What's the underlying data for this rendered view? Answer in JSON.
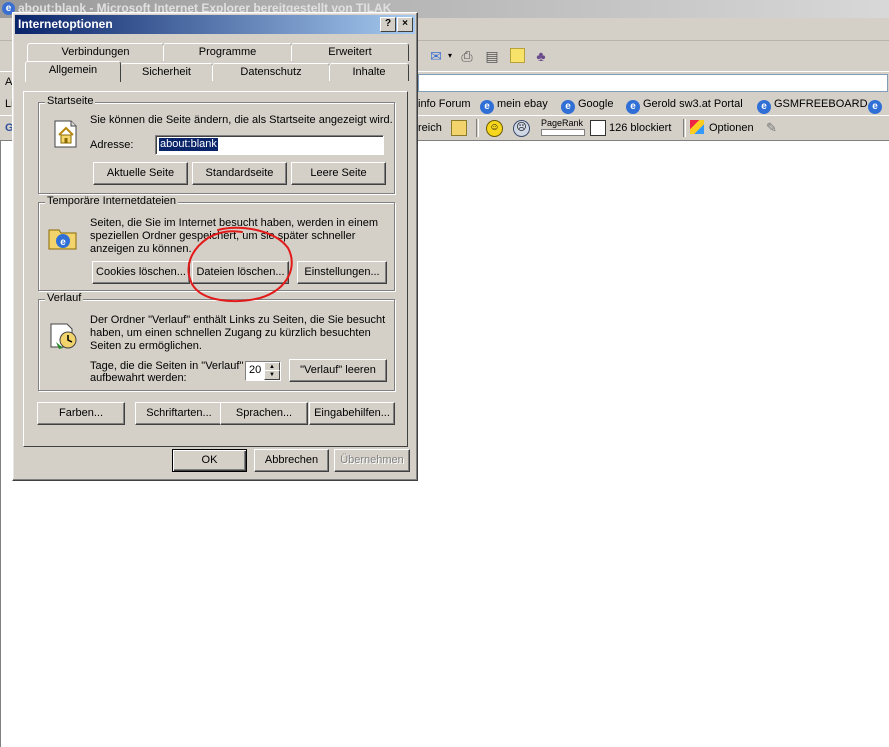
{
  "browser": {
    "title": "about:blank - Microsoft Internet Explorer bereitgestellt von TILAK",
    "address_prefix": "A",
    "links_prefix": "Li",
    "links": [
      "info Forum",
      "mein ebay",
      "Google",
      "Gerold sw3.at  Portal",
      "GSMFREEBOARD"
    ],
    "google_toolbar": {
      "search_fragment": "reich",
      "pagerank_label": "PageRank",
      "blocked_label": "126 blockiert",
      "options_label": "Optionen"
    }
  },
  "dialog": {
    "title": "Internetoptionen",
    "help_btn": "?",
    "close_btn": "×",
    "tabs_row1": [
      "Verbindungen",
      "Programme",
      "Erweitert"
    ],
    "tabs_row2": [
      "Allgemein",
      "Sicherheit",
      "Datenschutz",
      "Inhalte"
    ],
    "active_tab": "Allgemein",
    "startseite": {
      "label": "Startseite",
      "desc": "Sie können die Seite ändern, die als Startseite angezeigt wird.",
      "address_label": "Adresse:",
      "address_value": "about:blank",
      "btn_current": "Aktuelle Seite",
      "btn_default": "Standardseite",
      "btn_blank": "Leere Seite"
    },
    "temp": {
      "label": "Temporäre Internetdateien",
      "desc_line1": "Seiten, die Sie im Internet besucht haben, werden in einem",
      "desc_line2": "speziellen Ordner gespeichert, um sie später schneller",
      "desc_line3": "anzeigen zu können.",
      "btn_cookies": "Cookies löschen...",
      "btn_files": "Dateien löschen...",
      "btn_settings": "Einstellungen..."
    },
    "history": {
      "label": "Verlauf",
      "desc_line1": "Der Ordner \"Verlauf\" enthält Links zu Seiten, die Sie besucht",
      "desc_line2": "haben, um einen schnellen Zugang zu kürzlich besuchten",
      "desc_line3": "Seiten zu ermöglichen.",
      "days_line1": "Tage, die die Seiten in \"Verlauf\"",
      "days_line2": "aufbewahrt werden:",
      "days_value": "20",
      "btn_clear": "\"Verlauf\" leeren"
    },
    "bottom_buttons": [
      "Farben...",
      "Schriftarten...",
      "Sprachen...",
      "Eingabehilfen..."
    ],
    "ok": "OK",
    "cancel": "Abbrechen",
    "apply": "Übernehmen"
  },
  "annotation": {
    "color": "#e31a1a"
  }
}
